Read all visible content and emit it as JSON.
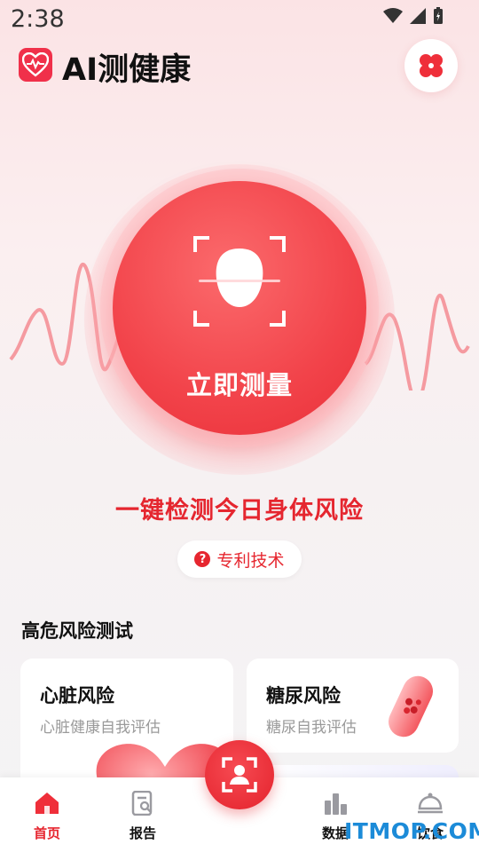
{
  "status_bar": {
    "time": "2:38"
  },
  "header": {
    "title": "AI测健康"
  },
  "hero": {
    "measure_label": "立即测量"
  },
  "slogan": "一键检测今日身体风险",
  "patent": {
    "question_glyph": "?",
    "label": "专利技术"
  },
  "section": {
    "title": "高危风险测试"
  },
  "cards": [
    {
      "title": "心脏风险",
      "subtitle": "心脏健康自我评估"
    },
    {
      "title": "糖尿风险",
      "subtitle": "糖尿自我评估"
    }
  ],
  "tabs": [
    {
      "label": "首页",
      "icon": "home-icon",
      "active": true
    },
    {
      "label": "报告",
      "icon": "report-icon",
      "active": false
    },
    {
      "label": "数据",
      "icon": "bar-chart-icon",
      "active": false
    },
    {
      "label": "饮食",
      "icon": "food-cloche-icon",
      "active": false
    }
  ],
  "watermark": "ITMOP.COM",
  "colors": {
    "accent": "#e6262f",
    "brand": "#f0304a",
    "watermark": "#1c8bd8"
  }
}
